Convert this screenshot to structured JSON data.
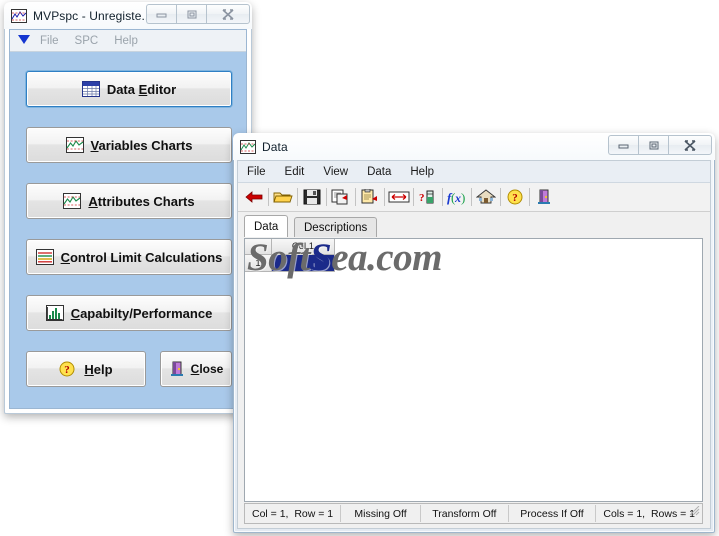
{
  "main_window": {
    "title": "MVPspc - Unregiste...",
    "title_icon": "chart-icon",
    "controls": {
      "minimize": "minimize-icon",
      "restore": "restore-icon",
      "close": "close-icon"
    },
    "menu": {
      "dropdown_icon": "blue-triangle-icon",
      "items": [
        "File",
        "SPC",
        "Help"
      ]
    },
    "buttons": [
      {
        "id": "data-editor",
        "pre": "Data ",
        "accel": "E",
        "post": "ditor",
        "icon": "grid-icon",
        "focused": true
      },
      {
        "id": "variables-charts",
        "pre": "",
        "accel": "V",
        "post": "ariables Charts",
        "icon": "chart-icon",
        "focused": false
      },
      {
        "id": "attributes-charts",
        "pre": "",
        "accel": "A",
        "post": "ttributes Charts",
        "icon": "chart-icon",
        "focused": false
      },
      {
        "id": "control-limits",
        "pre": "",
        "accel": "C",
        "post": "ontrol Limit Calculations",
        "icon": "lines-icon",
        "focused": false
      },
      {
        "id": "capability",
        "pre": "",
        "accel": "C",
        "post": "apabilty/Performance",
        "icon": "histogram-icon",
        "focused": false
      },
      {
        "id": "help",
        "pre": "",
        "accel": "H",
        "post": "elp",
        "icon": "question-ball-icon",
        "focused": false
      },
      {
        "id": "close",
        "pre": "",
        "accel": "C",
        "post": "lose",
        "icon": "exit-door-icon",
        "focused": false
      }
    ]
  },
  "data_window": {
    "title": "Data",
    "title_icon": "chart-icon",
    "controls": {
      "minimize": "minimize-icon",
      "restore": "restore-icon",
      "close": "close-icon"
    },
    "menu": [
      "File",
      "Edit",
      "View",
      "Data",
      "Help"
    ],
    "toolbar": [
      "back-arrow-icon",
      "open-folder-icon",
      "save-disk-icon",
      "copy-icon",
      "paste-icon",
      "column-width-icon",
      "test-tube-icon",
      "formula-fx-icon",
      "home-icon",
      "question-ball-icon",
      "exit-door-icon"
    ],
    "tabs": [
      {
        "label": "Data",
        "active": true
      },
      {
        "label": "Descriptions",
        "active": false
      }
    ],
    "grid": {
      "corner_label": "",
      "column_headers": [
        "Col 1"
      ],
      "row_headers": [
        "1"
      ],
      "selected_cell": {
        "col": 1,
        "row": 1
      }
    },
    "watermark": {
      "part1": "Soft",
      "part2": "S",
      "part3": "ea.com"
    },
    "statusbar": [
      "Col = 1,  Row = 1",
      "Missing Off",
      "Transform Off",
      "Process If Off",
      "Cols = 1,  Rows = 1"
    ]
  },
  "colors": {
    "panel_blue": "#a9c9ea",
    "selection_navy": "#1b2a8a",
    "focus_blue": "#2f7fc4",
    "accent_red": "#cc0000",
    "accent_yellow": "#ffd700"
  }
}
